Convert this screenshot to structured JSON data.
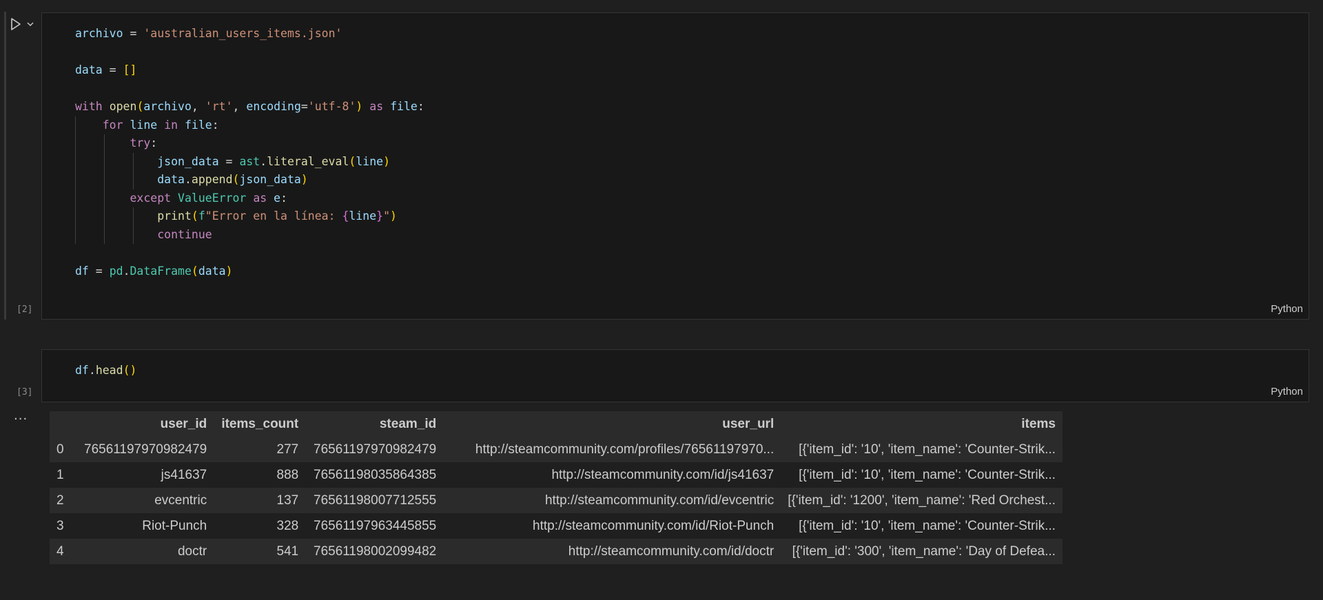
{
  "cells": [
    {
      "count": "[2]",
      "language": "Python",
      "lines": [
        [
          [
            "tk-var",
            "archivo"
          ],
          [
            "tk-op",
            " = "
          ],
          [
            "tk-str",
            "'australian_users_items.json'"
          ]
        ],
        [],
        [
          [
            "tk-var",
            "data"
          ],
          [
            "tk-op",
            " = "
          ],
          [
            "tk-br1",
            "[]"
          ]
        ],
        [],
        [
          [
            "tk-kw",
            "with"
          ],
          [
            "tk-op",
            " "
          ],
          [
            "tk-fn",
            "open"
          ],
          [
            "tk-br1",
            "("
          ],
          [
            "tk-var",
            "archivo"
          ],
          [
            "tk-op",
            ", "
          ],
          [
            "tk-str",
            "'rt'"
          ],
          [
            "tk-op",
            ", "
          ],
          [
            "tk-var",
            "encoding"
          ],
          [
            "tk-op",
            "="
          ],
          [
            "tk-str",
            "'utf-8'"
          ],
          [
            "tk-br1",
            ")"
          ],
          [
            "tk-op",
            " "
          ],
          [
            "tk-kw",
            "as"
          ],
          [
            "tk-op",
            " "
          ],
          [
            "tk-var",
            "file"
          ],
          [
            "tk-op",
            ":"
          ]
        ],
        [
          [
            "tk-op",
            "    "
          ],
          [
            "tk-kw",
            "for"
          ],
          [
            "tk-op",
            " "
          ],
          [
            "tk-var",
            "line"
          ],
          [
            "tk-op",
            " "
          ],
          [
            "tk-kw",
            "in"
          ],
          [
            "tk-op",
            " "
          ],
          [
            "tk-var",
            "file"
          ],
          [
            "tk-op",
            ":"
          ]
        ],
        [
          [
            "tk-op",
            "        "
          ],
          [
            "tk-kw",
            "try"
          ],
          [
            "tk-op",
            ":"
          ]
        ],
        [
          [
            "tk-op",
            "            "
          ],
          [
            "tk-var",
            "json_data"
          ],
          [
            "tk-op",
            " = "
          ],
          [
            "tk-cls",
            "ast"
          ],
          [
            "tk-op",
            "."
          ],
          [
            "tk-fn",
            "literal_eval"
          ],
          [
            "tk-br1",
            "("
          ],
          [
            "tk-var",
            "line"
          ],
          [
            "tk-br1",
            ")"
          ]
        ],
        [
          [
            "tk-op",
            "            "
          ],
          [
            "tk-var",
            "data"
          ],
          [
            "tk-op",
            "."
          ],
          [
            "tk-fn",
            "append"
          ],
          [
            "tk-br1",
            "("
          ],
          [
            "tk-var",
            "json_data"
          ],
          [
            "tk-br1",
            ")"
          ]
        ],
        [
          [
            "tk-op",
            "        "
          ],
          [
            "tk-kw",
            "except"
          ],
          [
            "tk-op",
            " "
          ],
          [
            "tk-cls",
            "ValueError"
          ],
          [
            "tk-op",
            " "
          ],
          [
            "tk-kw",
            "as"
          ],
          [
            "tk-op",
            " "
          ],
          [
            "tk-var",
            "e"
          ],
          [
            "tk-op",
            ":"
          ]
        ],
        [
          [
            "tk-op",
            "            "
          ],
          [
            "tk-fn",
            "print"
          ],
          [
            "tk-br1",
            "("
          ],
          [
            "tk-cls",
            "f"
          ],
          [
            "tk-str",
            "\"Error en la línea: "
          ],
          [
            "tk-br2",
            "{"
          ],
          [
            "tk-var",
            "line"
          ],
          [
            "tk-br2",
            "}"
          ],
          [
            "tk-str",
            "\""
          ],
          [
            "tk-br1",
            ")"
          ]
        ],
        [
          [
            "tk-op",
            "            "
          ],
          [
            "tk-kw",
            "continue"
          ]
        ],
        [],
        [
          [
            "tk-var",
            "df"
          ],
          [
            "tk-op",
            " = "
          ],
          [
            "tk-cls",
            "pd"
          ],
          [
            "tk-op",
            "."
          ],
          [
            "tk-cls",
            "DataFrame"
          ],
          [
            "tk-br1",
            "("
          ],
          [
            "tk-var",
            "data"
          ],
          [
            "tk-br1",
            ")"
          ]
        ]
      ]
    },
    {
      "count": "[3]",
      "language": "Python",
      "lines": [
        [
          [
            "tk-var",
            "df"
          ],
          [
            "tk-op",
            "."
          ],
          [
            "tk-fn",
            "head"
          ],
          [
            "tk-br1",
            "()"
          ]
        ]
      ]
    }
  ],
  "output": {
    "menu_label": "...",
    "columns": [
      "",
      "user_id",
      "items_count",
      "steam_id",
      "user_url",
      "items"
    ],
    "rows": [
      [
        "0",
        "76561197970982479",
        "277",
        "76561197970982479",
        "http://steamcommunity.com/profiles/76561197970...",
        "[{'item_id': '10', 'item_name': 'Counter-Strik..."
      ],
      [
        "1",
        "js41637",
        "888",
        "76561198035864385",
        "http://steamcommunity.com/id/js41637",
        "[{'item_id': '10', 'item_name': 'Counter-Strik..."
      ],
      [
        "2",
        "evcentric",
        "137",
        "76561198007712555",
        "http://steamcommunity.com/id/evcentric",
        "[{'item_id': '1200', 'item_name': 'Red Orchest..."
      ],
      [
        "3",
        "Riot-Punch",
        "328",
        "76561197963445855",
        "http://steamcommunity.com/id/Riot-Punch",
        "[{'item_id': '10', 'item_name': 'Counter-Strik..."
      ],
      [
        "4",
        "doctr",
        "541",
        "76561198002099482",
        "http://steamcommunity.com/id/doctr",
        "[{'item_id': '300', 'item_name': 'Day of Defea..."
      ]
    ]
  }
}
